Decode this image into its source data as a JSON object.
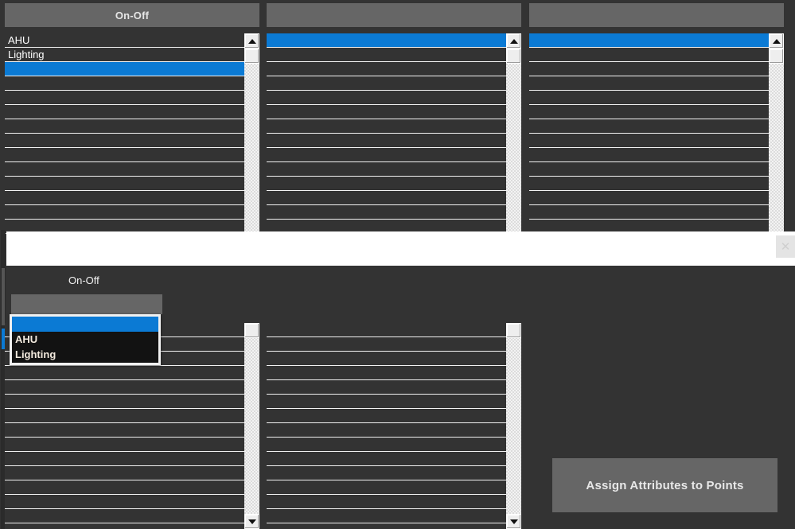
{
  "window": {
    "background": "#333333",
    "accent": "#0b7ad4",
    "panel": "#666666"
  },
  "top_section": {
    "columns": [
      {
        "header": "On-Off",
        "rows": [
          "AHU",
          "Lighting",
          "",
          "",
          "",
          "",
          "",
          "",
          "",
          "",
          "",
          "",
          "",
          ""
        ],
        "selected_index": 2,
        "scrollbar": {
          "up_arrow": "triangle-up",
          "thumb": true
        }
      },
      {
        "header": "",
        "rows": [
          "",
          "",
          "",
          "",
          "",
          "",
          "",
          "",
          "",
          "",
          "",
          "",
          "",
          ""
        ],
        "selected_index": 0,
        "scrollbar": {
          "up_arrow": "triangle-up",
          "thumb": true
        }
      },
      {
        "header": "",
        "rows": [
          "",
          "",
          "",
          "",
          "",
          "",
          "",
          "",
          "",
          "",
          "",
          "",
          "",
          ""
        ],
        "selected_index": 0,
        "scrollbar": {
          "up_arrow": "triangle-up",
          "thumb": true
        }
      }
    ]
  },
  "white_bar": {
    "close_icon": "close-icon",
    "close_label": "✕"
  },
  "mid_section": {
    "label": "On-Off",
    "combo_value": "",
    "dropdown_open": true,
    "dropdown_options": [
      "",
      "AHU",
      "Lighting"
    ],
    "dropdown_selected_index": 0
  },
  "bottom_section": {
    "columns": [
      {
        "rows": [
          "",
          "",
          "",
          "",
          "",
          "",
          "",
          "",
          "",
          "",
          "",
          "",
          "",
          ""
        ],
        "scrollbar": {
          "down_arrow": "triangle-down",
          "thumb": true
        }
      },
      {
        "rows": [
          "",
          "",
          "",
          "",
          "",
          "",
          "",
          "",
          "",
          "",
          "",
          "",
          "",
          ""
        ],
        "scrollbar": {
          "down_arrow": "triangle-down",
          "thumb": true
        }
      }
    ]
  },
  "actions": {
    "assign_button": "Assign Attributes to Points"
  }
}
